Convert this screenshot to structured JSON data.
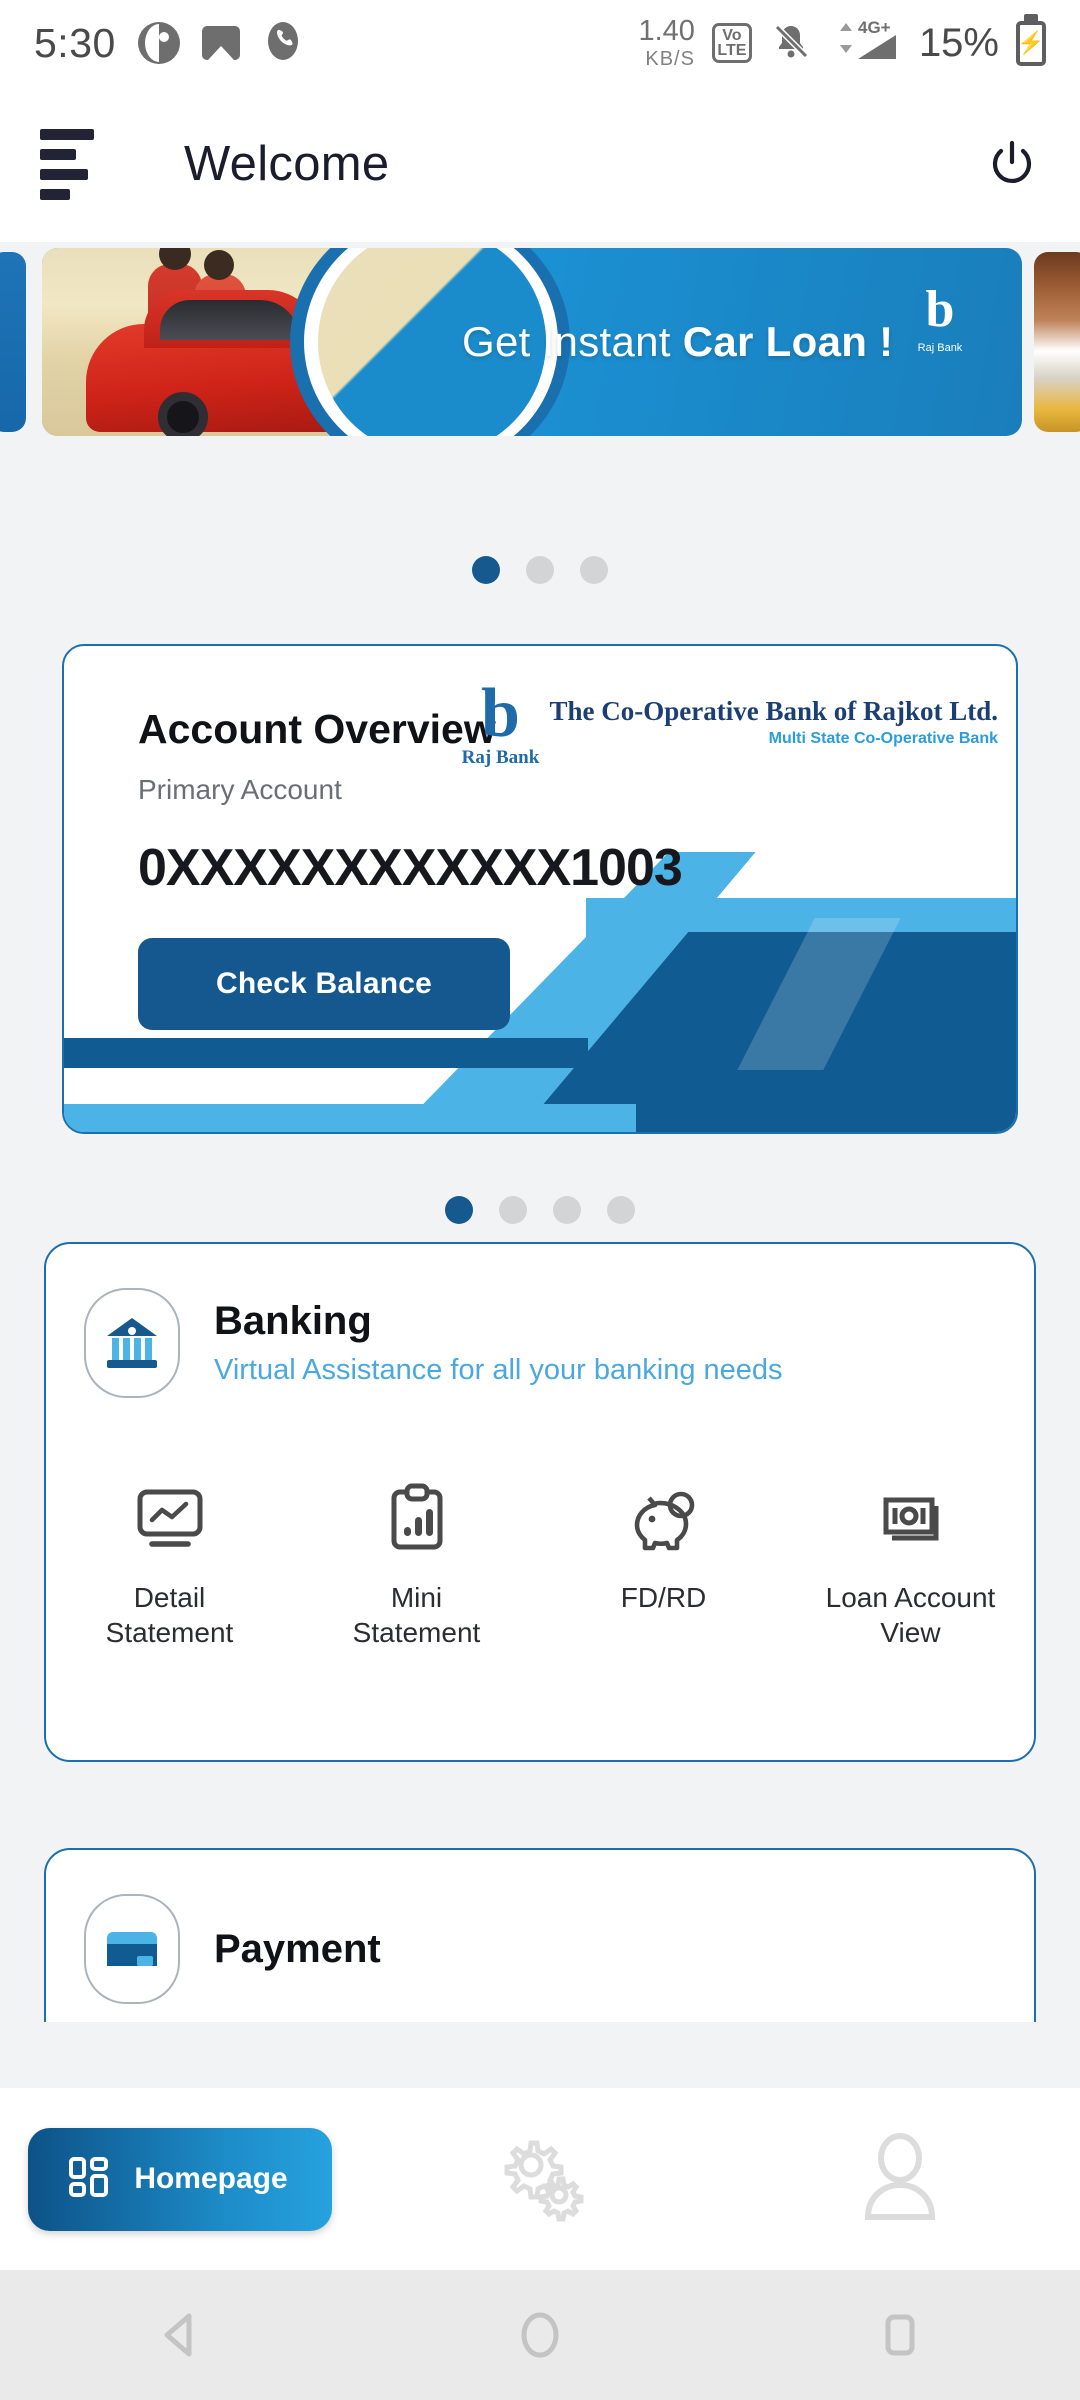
{
  "statusbar": {
    "time": "5:30",
    "icons_left": [
      "app-circle-icon",
      "gallery-icon",
      "phone-icon"
    ],
    "network_speed_value": "1.40",
    "network_speed_unit": "KB/S",
    "volte_top": "Vo",
    "volte_bottom": "LTE",
    "mute_icon": "bell-muted-icon",
    "signal_label": "4G+",
    "battery_percent": "15%",
    "battery_icon": "battery-charging-icon"
  },
  "appbar": {
    "menu_icon": "hamburger-menu-icon",
    "title": "Welcome",
    "power_icon": "power-icon"
  },
  "banner": {
    "text_plain": "Get Instant",
    "text_bold": "Car Loan !",
    "logo_mark": "b",
    "logo_sub": "Raj Bank",
    "dots_count": 3,
    "active_dot": 0
  },
  "account_card": {
    "title": "Account Overview",
    "subtitle": "Primary Account",
    "account_number": "0XXXXXXXXXXXX1003",
    "check_balance_label": "Check Balance",
    "bank_logo": {
      "mark": "b",
      "mark_label": "Raj Bank",
      "name_line1": "The Co-Operative Bank of Rajkot Ltd.",
      "name_line2": "Multi State Co-Operative Bank"
    },
    "dots_count": 4,
    "active_dot": 0
  },
  "banking_section": {
    "icon": "bank-building-icon",
    "title": "Banking",
    "subtitle": "Virtual Assistance for all your banking needs",
    "tiles": [
      {
        "icon": "monitor-chart-icon",
        "label": "Detail\nStatement",
        "line1": "Detail",
        "line2": "Statement"
      },
      {
        "icon": "clipboard-bars-icon",
        "label": "Mini\nStatement",
        "line1": "Mini",
        "line2": "Statement"
      },
      {
        "icon": "piggy-bank-icon",
        "label": "FD/RD",
        "line1": "FD/RD",
        "line2": ""
      },
      {
        "icon": "banknotes-icon",
        "label": "Loan Account\nView",
        "line1": "Loan Account",
        "line2": "View"
      }
    ]
  },
  "payment_section": {
    "icon": "payment-card-icon",
    "title": "Payment"
  },
  "bottomnav": {
    "items": [
      {
        "icon": "grid-dashboard-icon",
        "label": "Homepage",
        "active": true
      },
      {
        "icon": "settings-gears-icon",
        "label": "",
        "active": false
      },
      {
        "icon": "user-profile-icon",
        "label": "",
        "active": false
      }
    ]
  },
  "sysnav": {
    "back_icon": "back-triangle-icon",
    "home_icon": "home-circle-icon",
    "recents_icon": "recents-square-icon"
  },
  "colors": {
    "primary_dark": "#14588f",
    "primary": "#1a6fae",
    "accent_light": "#4cb3e6",
    "page_bg": "#f2f3f4",
    "dot_inactive": "#d2d4d6"
  }
}
